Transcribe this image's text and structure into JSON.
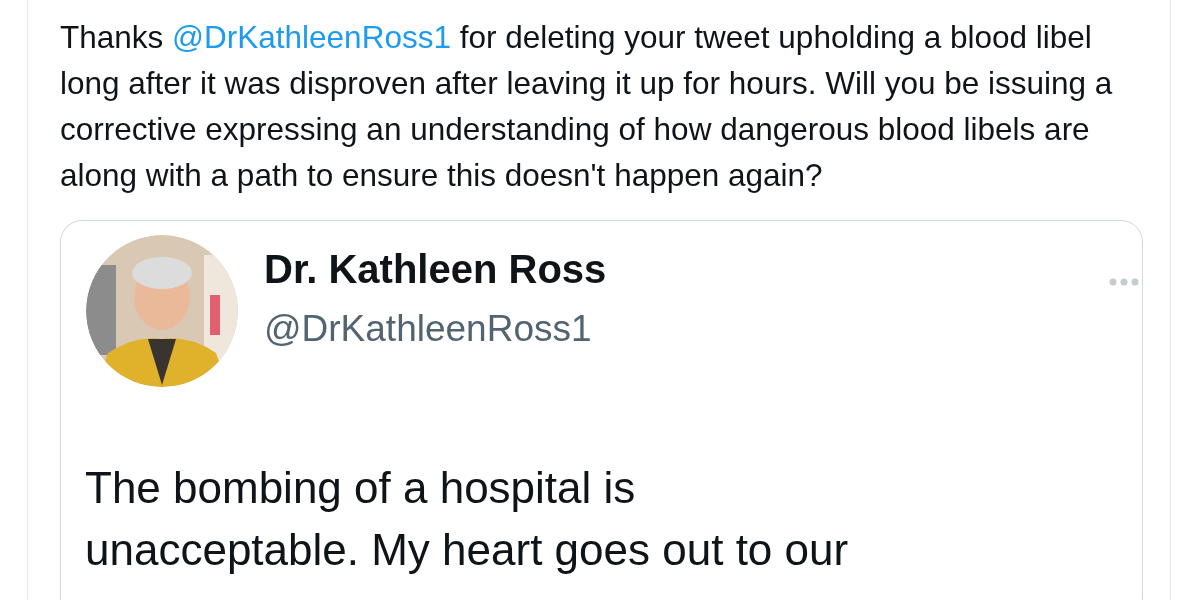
{
  "tweet": {
    "segments": [
      {
        "kind": "plain",
        "text": "Thanks "
      },
      {
        "kind": "mention",
        "text": "@DrKathleenRoss1"
      },
      {
        "kind": "plain",
        "text": " for deleting your tweet upholding a blood libel long after it was disproven after leaving it up for hours. Will you be issuing a corrective expressing an understanding of how dangerous blood libels are along with a path to ensure this doesn't happen again?"
      }
    ]
  },
  "quoted_tweet": {
    "avatar": {
      "kind": "picture"
    },
    "name": "Dr. Kathleen Ross",
    "handle": "@DrKathleenRoss1",
    "body_lines": [
      "The bombing of a hospital is",
      "unacceptable. My heart goes out to our"
    ]
  }
}
